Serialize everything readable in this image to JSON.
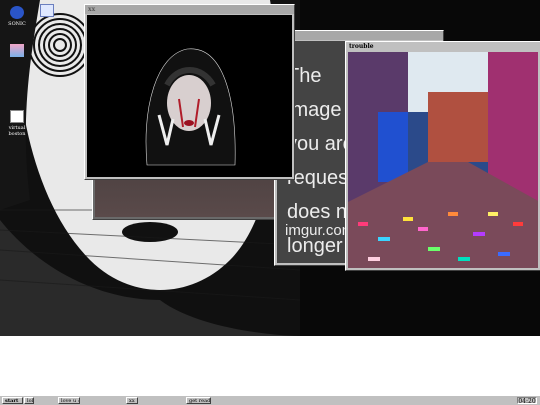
{
  "desktop": {
    "icons": [
      {
        "label": "SONIC"
      },
      {
        "label": ""
      },
      {
        "label": ""
      },
      {
        "label": "virtual boston"
      }
    ]
  },
  "windows": {
    "xx": {
      "title": "xx"
    },
    "imgur": {
      "title": "",
      "message": "The image you are requesting does no longer exist",
      "footer": "imgur.com"
    },
    "trouble": {
      "title": "trouble"
    }
  },
  "taskbar": {
    "start_label": "start",
    "buttons": [
      "lol",
      "love u :)",
      "xx",
      "get ready"
    ],
    "clock": "04:20"
  },
  "colors": {
    "taskbar": "#c0c0c0",
    "desktop_bg": "#3a3a3a",
    "white_area": "#ffffff"
  }
}
